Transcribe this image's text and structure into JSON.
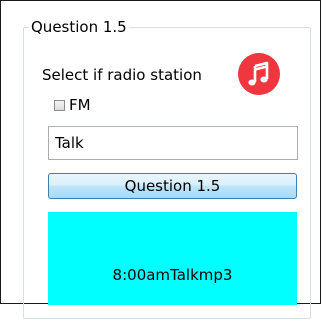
{
  "groupbox": {
    "title": "Question 1.5"
  },
  "prompt": "Select if radio station",
  "icon": {
    "name": "music-note-icon",
    "color": "#f0363f"
  },
  "checkbox": {
    "label": "FM",
    "checked": false
  },
  "input": {
    "value": "Talk"
  },
  "button": {
    "label": "Question 1.5"
  },
  "output": {
    "text": "8:00amTalkmp3",
    "background": "#00ffff"
  }
}
